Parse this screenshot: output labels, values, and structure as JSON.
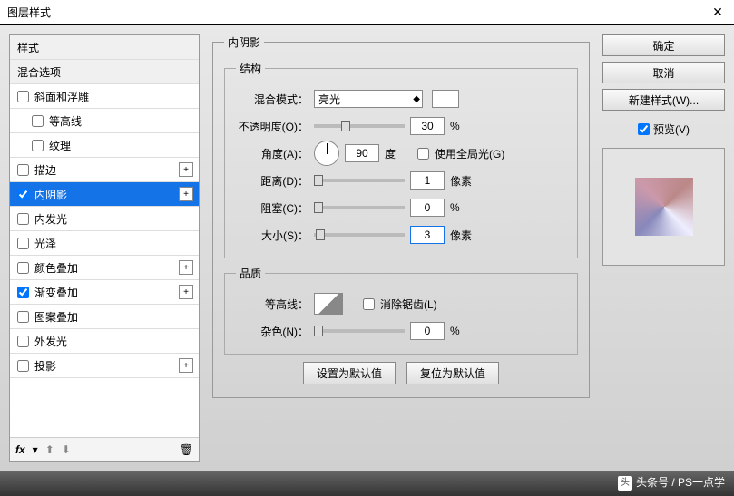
{
  "title": "图层样式",
  "sidebar": {
    "header_styles": "样式",
    "header_blend": "混合选项",
    "items": [
      {
        "label": "斜面和浮雕",
        "checked": false,
        "plus": false,
        "indent": 0
      },
      {
        "label": "等高线",
        "checked": false,
        "plus": false,
        "indent": 1
      },
      {
        "label": "纹理",
        "checked": false,
        "plus": false,
        "indent": 1
      },
      {
        "label": "描边",
        "checked": false,
        "plus": true,
        "indent": 0
      },
      {
        "label": "内阴影",
        "checked": true,
        "plus": true,
        "indent": 0,
        "selected": true
      },
      {
        "label": "内发光",
        "checked": false,
        "plus": false,
        "indent": 0
      },
      {
        "label": "光泽",
        "checked": false,
        "plus": false,
        "indent": 0
      },
      {
        "label": "颜色叠加",
        "checked": false,
        "plus": true,
        "indent": 0
      },
      {
        "label": "渐变叠加",
        "checked": true,
        "plus": true,
        "indent": 0
      },
      {
        "label": "图案叠加",
        "checked": false,
        "plus": false,
        "indent": 0
      },
      {
        "label": "外发光",
        "checked": false,
        "plus": false,
        "indent": 0
      },
      {
        "label": "投影",
        "checked": false,
        "plus": true,
        "indent": 0
      }
    ],
    "fx": "fx"
  },
  "panel": {
    "title": "内阴影",
    "group_structure": "结构",
    "group_quality": "品质",
    "blend_mode_label": "混合模式：",
    "blend_mode_value": "亮光",
    "opacity_label": "不透明度(O)：",
    "opacity_value": "30",
    "opacity_unit": "%",
    "angle_label": "角度(A)：",
    "angle_value": "90",
    "angle_unit": "度",
    "global_light_label": "使用全局光(G)",
    "distance_label": "距离(D)：",
    "distance_value": "1",
    "distance_unit": "像素",
    "choke_label": "阻塞(C)：",
    "choke_value": "0",
    "choke_unit": "%",
    "size_label": "大小(S)：",
    "size_value": "3",
    "size_unit": "像素",
    "contour_label": "等高线：",
    "antialias_label": "消除锯齿(L)",
    "noise_label": "杂色(N)：",
    "noise_value": "0",
    "noise_unit": "%",
    "btn_default": "设置为默认值",
    "btn_reset": "复位为默认值"
  },
  "buttons": {
    "ok": "确定",
    "cancel": "取消",
    "new_style": "新建样式(W)...",
    "preview": "预览(V)"
  },
  "watermark": "头条号 / PS一点学"
}
